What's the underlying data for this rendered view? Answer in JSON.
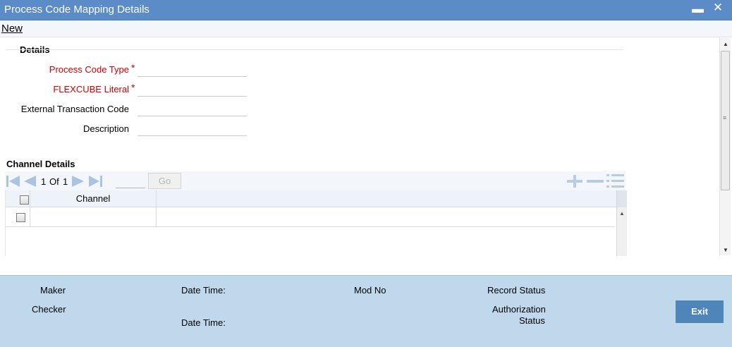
{
  "window": {
    "title": "Process Code Mapping Details",
    "minimize_icon": "minimize-icon",
    "close_icon": "close-icon"
  },
  "menu": {
    "new_label": "New"
  },
  "details": {
    "section_title": "Details",
    "fields": [
      {
        "label": "Process Code Type",
        "required": true,
        "value": ""
      },
      {
        "label": "FLEXCUBE Literal",
        "required": true,
        "value": ""
      },
      {
        "label": "External Transaction Code",
        "required": false,
        "value": ""
      },
      {
        "label": "Description",
        "required": false,
        "value": ""
      }
    ],
    "required_marker": "*"
  },
  "channel_details": {
    "section_title": "Channel Details",
    "pager": {
      "current": "1",
      "of_label": "Of",
      "total": "1",
      "go_label": "Go",
      "goto_value": ""
    },
    "columns": [
      "Channel"
    ],
    "rows": [
      {
        "channel": ""
      }
    ],
    "toolbar_icons": [
      "add-row-icon",
      "delete-row-icon",
      "view-row-icon"
    ]
  },
  "footer": {
    "maker_label": "Maker",
    "checker_label": "Checker",
    "datetime_label_1": "Date Time:",
    "datetime_label_2": "Date Time:",
    "modno_label": "Mod No",
    "record_status_label": "Record Status",
    "auth_status_label_line1": "Authorization",
    "auth_status_label_line2": "Status",
    "exit_label": "Exit"
  },
  "colors": {
    "titlebar": "#5b8cc7",
    "footer": "#bfd8ec",
    "required": "#d00000",
    "exit_button": "#4f86ba"
  }
}
